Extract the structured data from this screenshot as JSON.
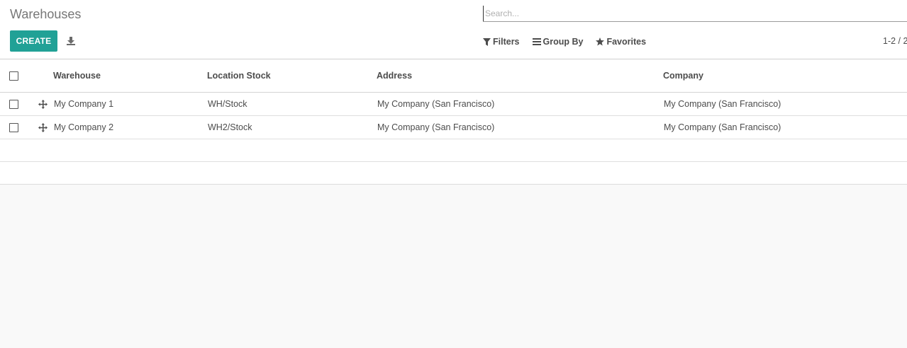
{
  "breadcrumb": {
    "title": "Warehouses"
  },
  "search": {
    "placeholder": "Search...",
    "value": ""
  },
  "buttons": {
    "create_label": "CREATE",
    "download_icon": "download-icon"
  },
  "search_options": {
    "filters": {
      "label": "Filters",
      "icon": "filter-icon"
    },
    "group_by": {
      "label": "Group By",
      "icon": "bars-icon"
    },
    "favorites": {
      "label": "Favorites",
      "icon": "star-icon"
    }
  },
  "pager": {
    "text": "1-2 / 2"
  },
  "table": {
    "columns": {
      "warehouse": "Warehouse",
      "location_stock": "Location Stock",
      "address": "Address",
      "company": "Company"
    },
    "rows": [
      {
        "warehouse": "My Company 1",
        "location_stock": "WH/Stock",
        "address": "My Company (San Francisco)",
        "company": "My Company (San Francisco)"
      },
      {
        "warehouse": "My Company 2",
        "location_stock": "WH2/Stock",
        "address": "My Company (San Francisco)",
        "company": "My Company (San Francisco)"
      }
    ]
  },
  "colors": {
    "accent": "#21a196",
    "text": "#4c4c4c",
    "muted": "#777777"
  }
}
